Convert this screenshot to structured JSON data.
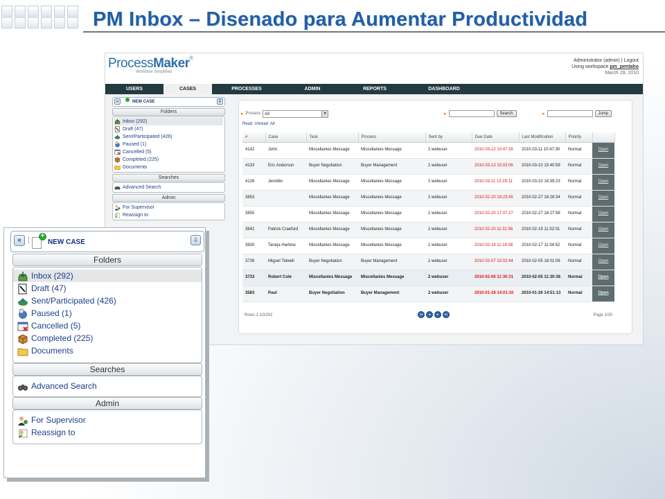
{
  "slide": {
    "title": "PM Inbox – Disenado para Aumentar Productividad"
  },
  "header": {
    "logo_brand_light": "Process",
    "logo_brand_bold": "Maker",
    "logo_tagline": "Workflow Simplified",
    "user_line": "Administrator (admin) | Logout",
    "workspace_prefix": "Using workspace ",
    "workspace_name": "pm_pentaho",
    "date": "March 29, 2010"
  },
  "nav": [
    {
      "label": "USERS"
    },
    {
      "label": "CASES",
      "active": true
    },
    {
      "label": "PROCESSES"
    },
    {
      "label": "ADMIN"
    },
    {
      "label": "REPORTS"
    },
    {
      "label": "DASHBOARD"
    }
  ],
  "sidebar": {
    "new_case_label": "NEW CASE",
    "folders_title": "Folders",
    "folders": [
      {
        "label": "Inbox (292)",
        "icon": "inbox-icon",
        "selected": true
      },
      {
        "label": "Draft (47)",
        "icon": "draft-icon"
      },
      {
        "label": "Sent/Participated (426)",
        "icon": "sent-icon"
      },
      {
        "label": "Paused (1)",
        "icon": "paused-icon"
      },
      {
        "label": "Cancelled (5)",
        "icon": "cancelled-icon"
      },
      {
        "label": "Completed (225)",
        "icon": "completed-icon"
      },
      {
        "label": "Documents",
        "icon": "folder-icon"
      }
    ],
    "searches_title": "Searches",
    "searches": [
      {
        "label": "Advanced Search",
        "icon": "binoculars-icon"
      }
    ],
    "admin_title": "Admin",
    "admin": [
      {
        "label": "For Supervisor",
        "icon": "supervisor-icon"
      },
      {
        "label": "Reassign to",
        "icon": "reassign-icon"
      }
    ]
  },
  "inbox": {
    "process_label": "Process",
    "process_value": "All",
    "search_button": "Search",
    "jump_button": "Jump",
    "filter_read": "Read",
    "filter_unread": "Unread",
    "filter_all": "All",
    "columns": [
      "#",
      "Case",
      "Task",
      "Process",
      "Sent by",
      "Due Date",
      "Last Modification",
      "Priority",
      ""
    ],
    "rows": [
      {
        "num": "4142",
        "case": "John",
        "task": "Miscellanies Message",
        "process": "Miscellanies Message",
        "sent_by": "2 webuser",
        "due": "2010-03-12 10:47:28",
        "last_mod": "2010-03-11 10:47:30",
        "priority": "Normal",
        "action": "Open"
      },
      {
        "num": "4133",
        "case": "Eric Anderson",
        "task": "Buyer Negotiation",
        "process": "Buyer Management",
        "sent_by": "2 webuser",
        "due": "2010-03-13 15:03:06",
        "last_mod": "2010-03-10 15:40:59",
        "priority": "Normal",
        "action": "Open"
      },
      {
        "num": "4126",
        "case": "Jennifer",
        "task": "Miscellanies Message",
        "process": "Miscellanies Message",
        "sent_by": "2 webuser",
        "due": "2010-03-11 13:29:11",
        "last_mod": "2010-03-10 16:39:23",
        "priority": "Normal",
        "action": "Open"
      },
      {
        "num": "3853",
        "case": "",
        "task": "Miscellanies Message",
        "process": "Miscellanies Message",
        "sent_by": "2 webuser",
        "due": "2010-02-20 18:23:45",
        "last_mod": "2010-02-27 16:28:34",
        "priority": "Normal",
        "action": "Open"
      },
      {
        "num": "3850",
        "case": "",
        "task": "Miscellanies Message",
        "process": "Miscellanies Message",
        "sent_by": "2 webuser",
        "due": "2010-02-20 17:07:27",
        "last_mod": "2010-02-27 16:27:58",
        "priority": "Normal",
        "action": "Open"
      },
      {
        "num": "3842",
        "case": "Patrick Craeford",
        "task": "Miscellanies Message",
        "process": "Miscellanies Message",
        "sent_by": "2 webuser",
        "due": "2010-02-20 11:31:56",
        "last_mod": "2010-02-19 11:32:01",
        "priority": "Normal",
        "action": "Open"
      },
      {
        "num": "3830",
        "case": "Taneja Hartlow",
        "task": "Miscellanies Message",
        "process": "Miscellanies Message",
        "sent_by": "2 webuser",
        "due": "2010-02-18 11:16:08",
        "last_mod": "2010-02-17 11:34:52",
        "priority": "Normal",
        "action": "Open"
      },
      {
        "num": "3739",
        "case": "Miguel Tidwell",
        "task": "Buyer Negotiation",
        "process": "Buyer Management",
        "sent_by": "2 webuser",
        "due": "2010-02-07 15:02:44",
        "last_mod": "2010-02-05 16:01:06",
        "priority": "Normal",
        "action": "Open"
      },
      {
        "num": "3733",
        "case": "Robert Cole",
        "task": "Miscellanies Message",
        "process": "Miscellanies Message",
        "sent_by": "2 webuser",
        "due": "2010-02-06 11:30:31",
        "last_mod": "2010-02-05 11:30:36",
        "priority": "Normal",
        "action": "Open",
        "bold": true
      },
      {
        "num": "3583",
        "case": "Paul",
        "task": "Buyer Negotiation",
        "process": "Buyer Management",
        "sent_by": "2 webuser",
        "due": "2010-01-28 14:01:10",
        "last_mod": "2010-01-26 14:51:13",
        "priority": "Normal",
        "action": "Open",
        "bold": true
      }
    ],
    "rows_info": "Rows 1-10/292",
    "page_info": "Page 1/30"
  },
  "colors": {
    "title": "#1f5fa9",
    "nav_bg": "#223a40",
    "due_date": "#e01414",
    "link": "#1b3e8c",
    "open_cell": "#5e6d70"
  }
}
